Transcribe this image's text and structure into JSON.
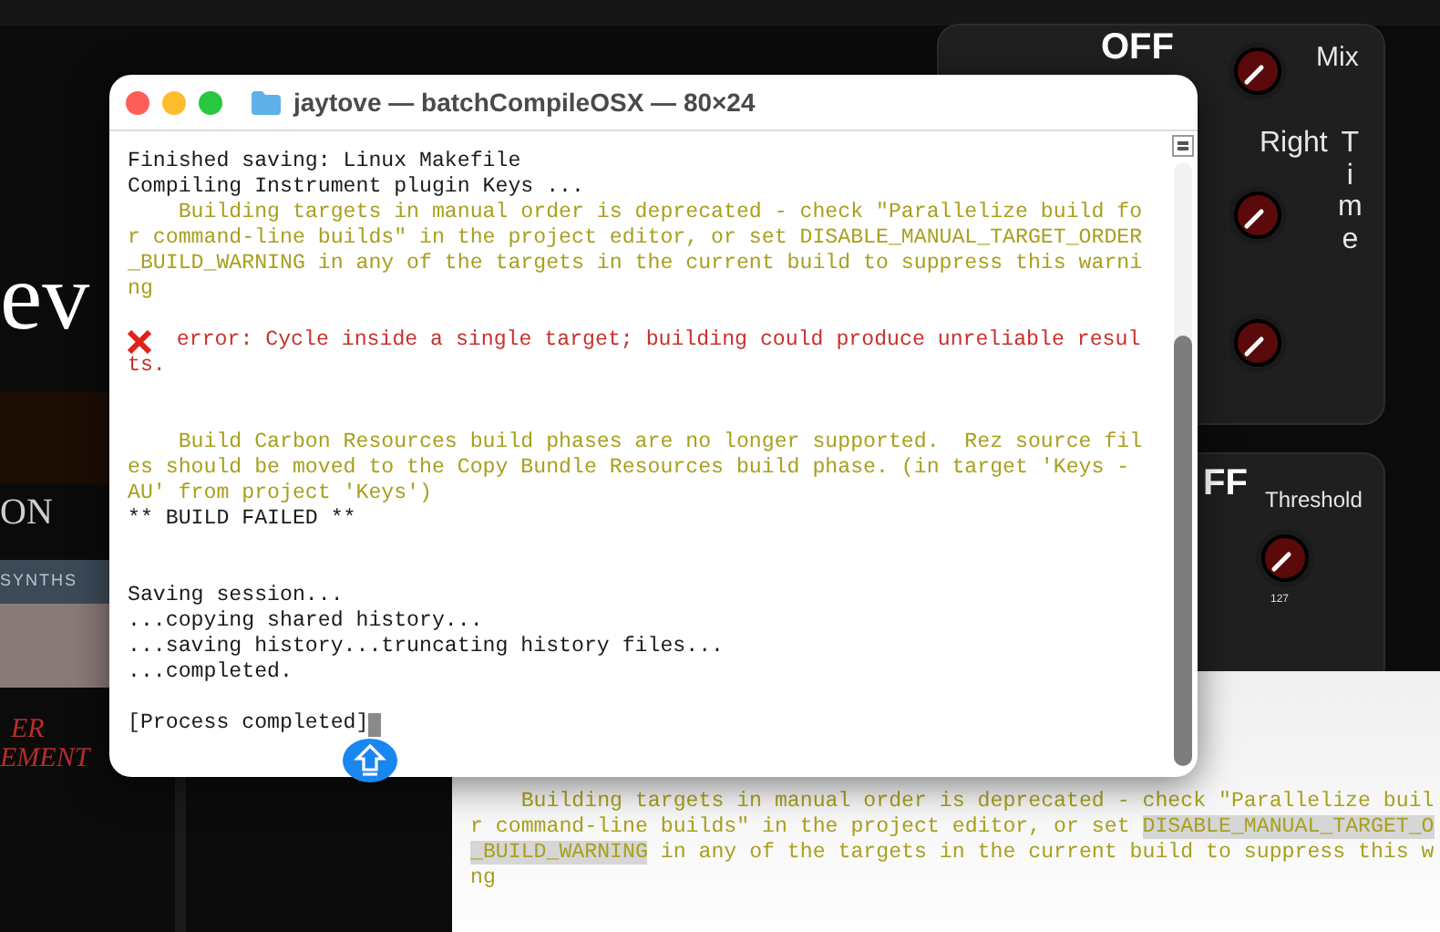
{
  "plugin": {
    "logo_fragment": "ev",
    "button_fragment": "ON",
    "synth_banner": "SYNTHS",
    "promo_lines": [
      "ER",
      "EMENT"
    ],
    "delay_panel": {
      "switch": "OFF",
      "switch_on": false,
      "mix_label": "Mix",
      "right_label": "Right",
      "time_label": "Time"
    },
    "dynamics_panel": {
      "switch": "FF",
      "switch_on": false,
      "threshold_label": "Threshold",
      "knob_value": "127"
    }
  },
  "terminal": {
    "title": "jaytove — batchCompileOSX — 80×24",
    "lines": [
      {
        "kind": "plain",
        "text": "Finished saving: Linux Makefile"
      },
      {
        "kind": "plain",
        "text": "Compiling Instrument plugin Keys ..."
      },
      {
        "kind": "warning",
        "text": "    Building targets in manual order is deprecated - check \"Parallelize build fo"
      },
      {
        "kind": "warning",
        "text": "r command-line builds\" in the project editor, or set DISABLE_MANUAL_TARGET_ORDER"
      },
      {
        "kind": "warning",
        "text": "_BUILD_WARNING in any of the targets in the current build to suppress this warni"
      },
      {
        "kind": "warning",
        "text": "ng"
      },
      {
        "kind": "blank"
      },
      {
        "kind": "error",
        "text": "  error: Cycle inside a single target; building could produce unreliable resul"
      },
      {
        "kind": "errorcont",
        "text": "ts."
      },
      {
        "kind": "blank"
      },
      {
        "kind": "blank"
      },
      {
        "kind": "warning",
        "text": "    Build Carbon Resources build phases are no longer supported.  Rez source fil"
      },
      {
        "kind": "warning",
        "text": "es should be moved to the Copy Bundle Resources build phase. (in target 'Keys -"
      },
      {
        "kind": "warning",
        "text": "AU' from project 'Keys')"
      },
      {
        "kind": "plain",
        "text": "** BUILD FAILED **"
      },
      {
        "kind": "blank"
      },
      {
        "kind": "blank"
      },
      {
        "kind": "plain",
        "text": "Saving session..."
      },
      {
        "kind": "plain",
        "text": "...copying shared history..."
      },
      {
        "kind": "plain",
        "text": "...saving history...truncating history files..."
      },
      {
        "kind": "plain",
        "text": "...completed."
      },
      {
        "kind": "blank"
      },
      {
        "kind": "prompt",
        "text": "[Process completed]"
      }
    ]
  },
  "back_terminal": {
    "lines": [
      {
        "kind": "warning",
        "parts": [
          {
            "text": "    Building targets in manual order is deprecated - check \"Parallelize buil",
            "highlighted": false
          }
        ]
      },
      {
        "kind": "warning",
        "parts": [
          {
            "text": "r command-line builds\" in the project editor, or set ",
            "highlighted": false
          },
          {
            "text": "DISABLE_MANUAL_TARGET_O",
            "highlighted": true
          }
        ]
      },
      {
        "kind": "warning",
        "parts": [
          {
            "text": "_BUILD_WARNING",
            "highlighted": true
          },
          {
            "text": " in any of the targets in the current build to suppress this w",
            "highlighted": false
          }
        ]
      },
      {
        "kind": "warning",
        "parts": [
          {
            "text": "ng",
            "highlighted": false
          }
        ]
      }
    ]
  }
}
